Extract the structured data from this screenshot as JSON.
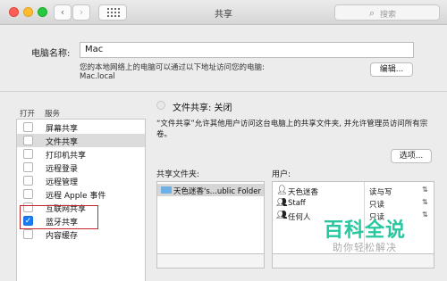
{
  "window": {
    "title": "共享"
  },
  "toolbar": {
    "search_placeholder": "搜索",
    "back_glyph": "‹",
    "forward_glyph": "›"
  },
  "computer": {
    "label": "电脑名称:",
    "name": "Mac",
    "note": "您的本地网络上的电脑可以通过以下地址访问您的电脑:",
    "local_address": "Mac.local",
    "edit_button": "编辑..."
  },
  "services": {
    "col_on": "打开",
    "col_service": "服务",
    "items": [
      {
        "label": "屏幕共享",
        "checked": false,
        "selected": false
      },
      {
        "label": "文件共享",
        "checked": false,
        "selected": true
      },
      {
        "label": "打印机共享",
        "checked": false,
        "selected": false
      },
      {
        "label": "远程登录",
        "checked": false,
        "selected": false
      },
      {
        "label": "远程管理",
        "checked": false,
        "selected": false
      },
      {
        "label": "远程 Apple 事件",
        "checked": false,
        "selected": false
      },
      {
        "label": "互联网共享",
        "checked": false,
        "selected": false
      },
      {
        "label": "蓝牙共享",
        "checked": true,
        "selected": false
      },
      {
        "label": "内容缓存",
        "checked": false,
        "selected": false
      }
    ]
  },
  "detail": {
    "status": "文件共享: 关闭",
    "description": "“文件共享”允许其他用户访问这台电脑上的共享文件夹, 并允许管理员访问所有宗卷。",
    "options_button": "选项...",
    "shared_folders_header": "共享文件夹:",
    "users_header": "用户:",
    "shared_folders": [
      "天色迷香's...ublic Folder"
    ],
    "users": [
      {
        "name": "天色迷香",
        "permission": "读与写",
        "icon": "single-user-icon"
      },
      {
        "name": "Staff",
        "permission": "只读",
        "icon": "group-icon"
      },
      {
        "name": "任何人",
        "permission": "只读",
        "icon": "everyone-icon"
      }
    ]
  },
  "watermark": {
    "title": "百科全说",
    "subtitle": "助你轻松解决"
  },
  "colors": {
    "accent": "#1a7cf3",
    "highlight_box": "#c4262b",
    "watermark": "#27c7a0"
  }
}
